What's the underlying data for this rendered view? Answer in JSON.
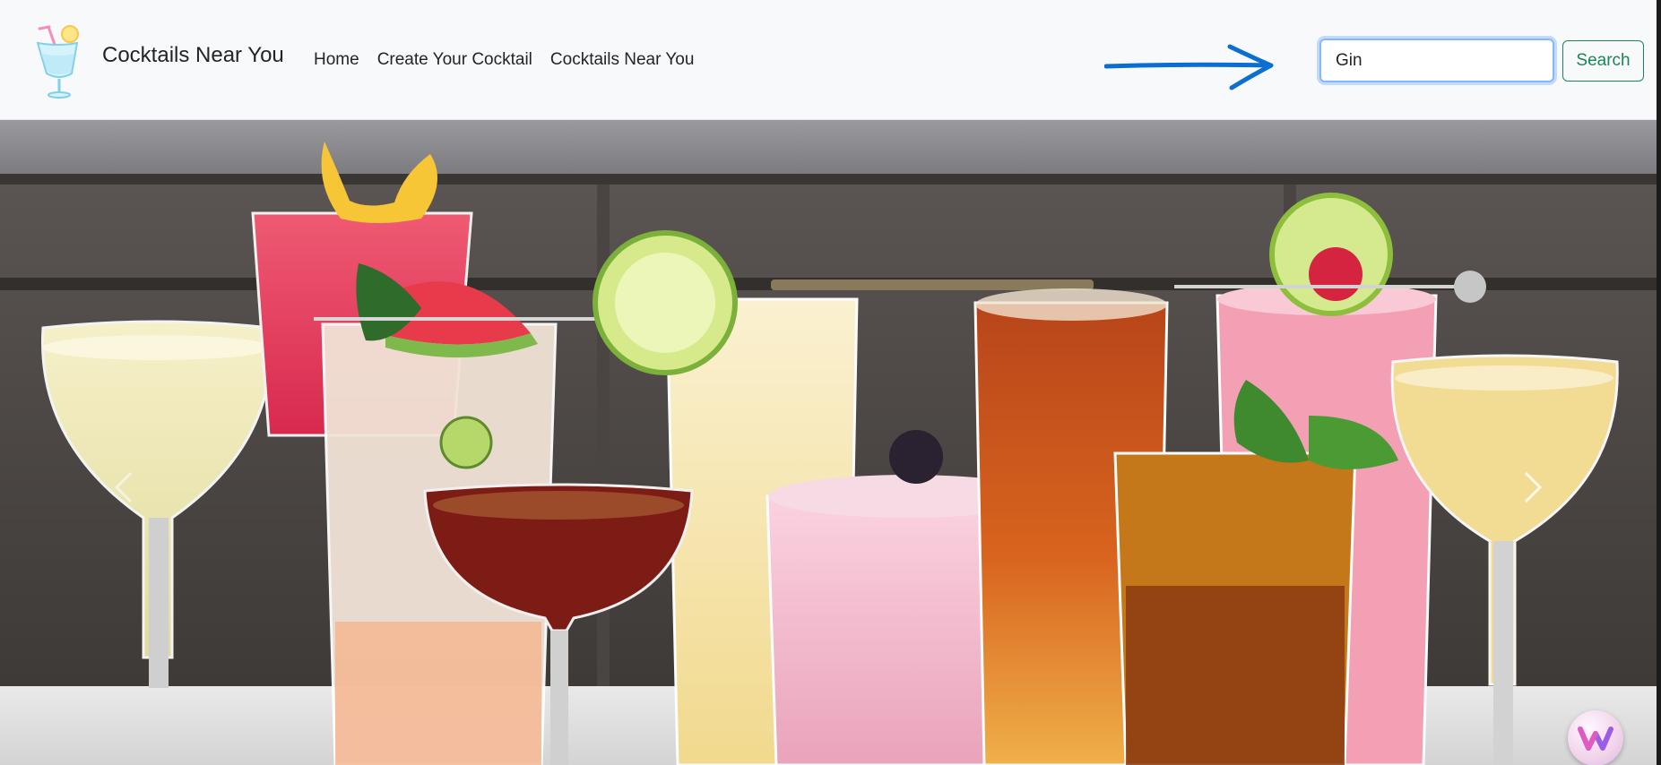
{
  "header": {
    "brand": "Cocktails Near You",
    "nav": [
      {
        "label": "Home"
      },
      {
        "label": "Create Your Cocktail"
      },
      {
        "label": "Cocktails Near You"
      }
    ],
    "search": {
      "value": "Gin",
      "button_label": "Search"
    }
  },
  "hero": {
    "controls": {
      "prev_icon": "chevron-left-icon",
      "next_icon": "chevron-right-icon"
    }
  },
  "colors": {
    "navbar_bg": "#f8f9fa",
    "search_border_focus": "#86b7fe",
    "search_button": "#198754",
    "annotation_arrow": "#0a6fd0"
  }
}
